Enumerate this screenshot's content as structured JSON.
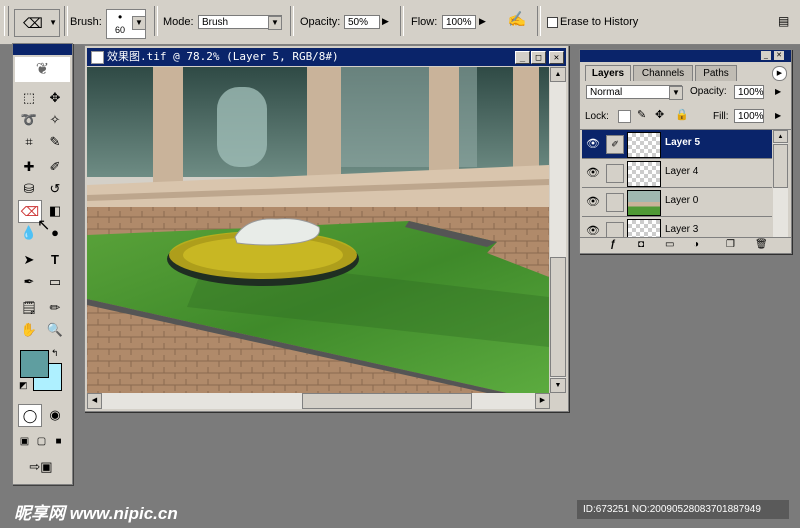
{
  "options_bar": {
    "brush_label": "Brush:",
    "brush_size": "60",
    "mode_label": "Mode:",
    "mode_value": "Brush",
    "opacity_label": "Opacity:",
    "opacity_value": "50%",
    "flow_label": "Flow:",
    "flow_value": "100%",
    "erase_history_label": "Erase to History"
  },
  "document": {
    "title": "效果图.tif @ 78.2% (Layer 5, RGB/8#)"
  },
  "layers_panel": {
    "tabs": [
      "Layers",
      "Channels",
      "Paths"
    ],
    "blend_mode": "Normal",
    "opacity_label": "Opacity:",
    "opacity_value": "100%",
    "lock_label": "Lock:",
    "fill_label": "Fill:",
    "fill_value": "100%",
    "layers": [
      {
        "name": "Layer 5",
        "selected": true
      },
      {
        "name": "Layer 4",
        "selected": false
      },
      {
        "name": "Layer 0",
        "selected": false
      },
      {
        "name": "Layer 3",
        "selected": false
      }
    ]
  },
  "colors": {
    "foreground": "#5f9ea0",
    "background": "#aef0ff",
    "title_bar": "#0a246a"
  },
  "watermark": {
    "logo": "昵享网 www.nipic.cn",
    "id_text": "ID:673251 NO:20090528083701887949"
  }
}
